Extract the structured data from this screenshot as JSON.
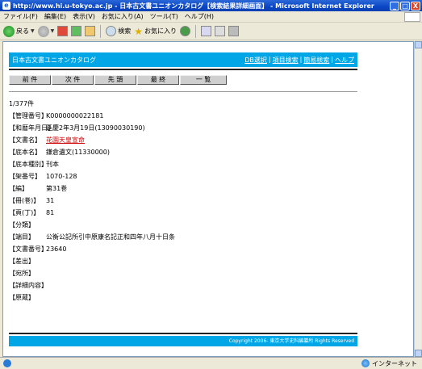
{
  "window": {
    "title": "http://www.hi.u-tokyo.ac.jp - 日本古文書ユニオンカタログ【検索結果詳細画面】 - Microsoft Internet Explorer",
    "min": "_",
    "max": "□",
    "close": "X"
  },
  "menu": [
    "ファイル(F)",
    "編集(E)",
    "表示(V)",
    "お気に入り(A)",
    "ツール(T)",
    "ヘルプ(H)"
  ],
  "toolbar": {
    "back_label": "戻る",
    "search_label": "検索",
    "favorites_label": "お気に入り"
  },
  "page": {
    "brand": "日本古文書ユニオンカタログ",
    "links": [
      "DB選択",
      "項目検索",
      "簡易検索",
      "ヘルプ"
    ],
    "nav_buttons": [
      "前 件",
      "次 件",
      "先 頭",
      "最 終",
      "一 覧"
    ],
    "count": "1/377件",
    "fields": [
      {
        "label": "【管理番号】",
        "value": "K0000000022181",
        "link": false
      },
      {
        "label": "【和暦年月日】",
        "value": "延慶2年3月19日(13090030190)",
        "link": false
      },
      {
        "label": "【文書名】",
        "value": "花園天皇宣命",
        "link": true
      },
      {
        "label": "【底本名】",
        "value": "鎌倉遺文(11330000)",
        "link": false
      },
      {
        "label": "【底本種別】",
        "value": "刊本",
        "link": false
      },
      {
        "label": "【架番号】",
        "value": "1070-128",
        "link": false
      },
      {
        "label": "【編】",
        "value": "第31巻",
        "link": false
      },
      {
        "label": "【冊(巻)】",
        "value": "31",
        "link": false
      },
      {
        "label": "【頁(丁)】",
        "value": "81",
        "link": false
      },
      {
        "label": "【分類】",
        "value": "",
        "link": false
      },
      {
        "label": "【端目】",
        "value": "公衡公記所引中原康名記正和四年八月十日条",
        "link": false
      },
      {
        "label": "【文書番号】",
        "value": "23640",
        "link": false
      },
      {
        "label": "【差出】",
        "value": "",
        "link": false
      },
      {
        "label": "【宛所】",
        "value": "",
        "link": false
      },
      {
        "label": "【詳細内容】",
        "value": "",
        "link": false
      },
      {
        "label": "【原蔵】",
        "value": "",
        "link": false
      }
    ],
    "footer": "Copyright 2006- 東京大学史料編纂所 Rights Reserved"
  },
  "status": {
    "zone": "インターネット"
  },
  "colors": {
    "accent": "#00a6e6",
    "link": "#cc0000"
  }
}
